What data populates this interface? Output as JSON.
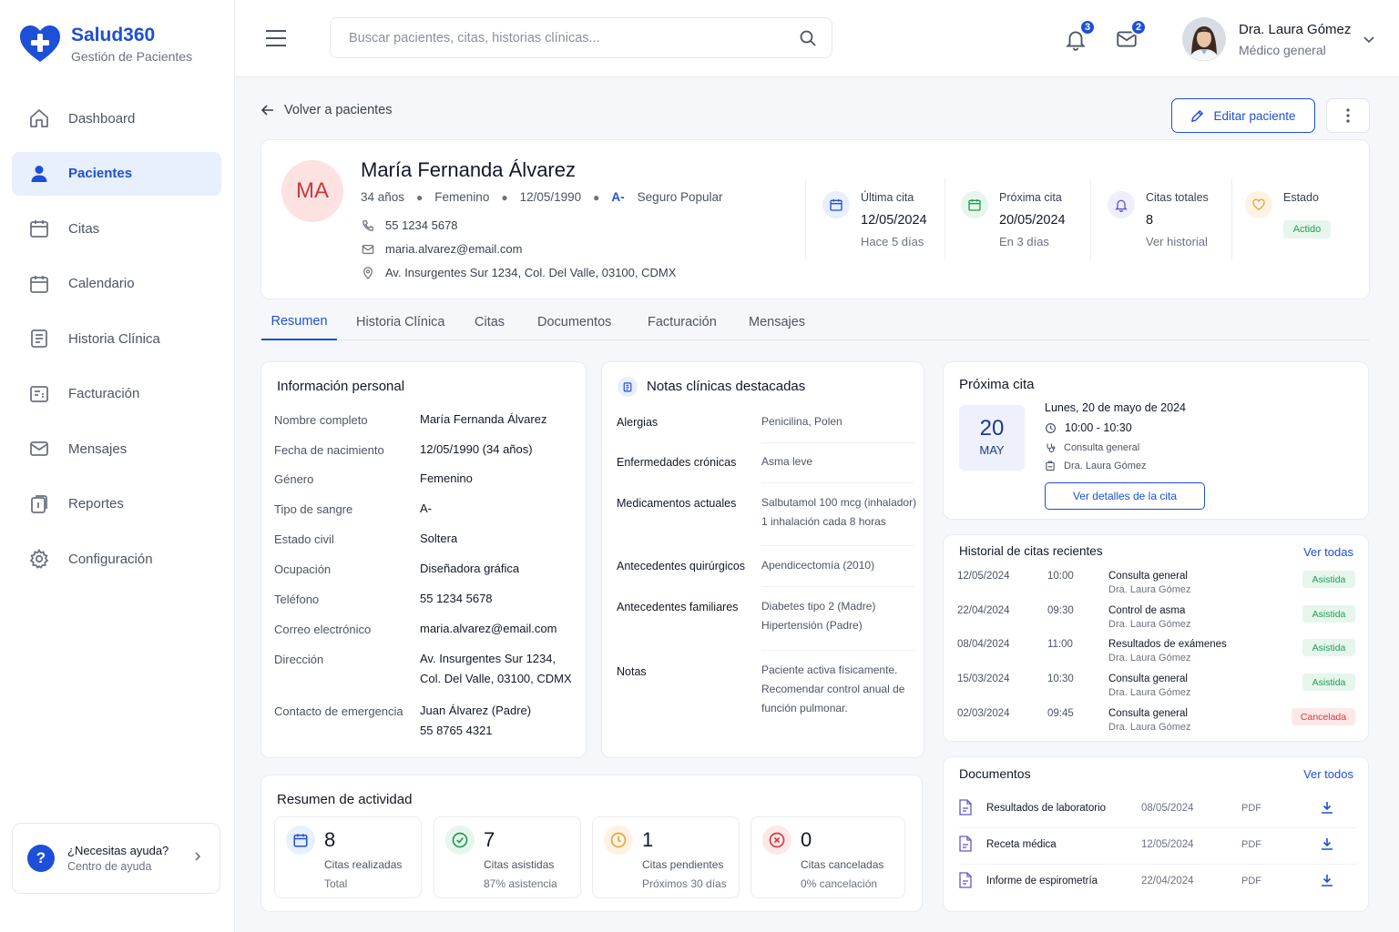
{
  "brand": {
    "name": "Salud360",
    "subtitle": "Gestión de Pacientes",
    "logo_icon": "heart-plus-icon",
    "color": "#1e4fd8"
  },
  "sidebar": {
    "items": [
      {
        "label": "Dashboard",
        "icon": "home-icon",
        "active": false
      },
      {
        "label": "Pacientes",
        "icon": "user-icon",
        "active": true
      },
      {
        "label": "Citas",
        "icon": "calendar-icon",
        "active": false
      },
      {
        "label": "Calendario",
        "icon": "calendar-icon",
        "active": false
      },
      {
        "label": "Historia Clínica",
        "icon": "document-icon",
        "active": false
      },
      {
        "label": "Facturación",
        "icon": "invoice-icon",
        "active": false
      },
      {
        "label": "Mensajes",
        "icon": "mail-icon",
        "active": false
      },
      {
        "label": "Reportes",
        "icon": "report-icon",
        "active": false
      },
      {
        "label": "Configuración",
        "icon": "gear-icon",
        "active": false
      }
    ],
    "help": {
      "title": "¿Necesitas ayuda?",
      "subtitle": "Centro de ayuda",
      "icon_text": "?"
    }
  },
  "header": {
    "search_placeholder": "Buscar pacientes, citas, historias clínicas...",
    "notifications_count": "3",
    "messages_count": "2",
    "user": {
      "name": "Dra. Laura Gómez",
      "role": "Médico general"
    }
  },
  "actions": {
    "back_label": "Volver a pacientes",
    "edit_label": "Editar paciente"
  },
  "patient": {
    "initials": "MA",
    "name": "María Fernanda Álvarez",
    "age": "34 años",
    "gender": "Femenino",
    "dob": "12/05/1990",
    "blood": "A-",
    "insurance": "Seguro Popular",
    "phone": "55 1234 5678",
    "email": "maria.alvarez@email.com",
    "address": "Av. Insurgentes Sur 1234, Col. Del Valle, 03100, CDMX",
    "stats": [
      {
        "label": "Última cita",
        "value": "12/05/2024",
        "sub": "Hace 5 días",
        "icon": "calendar-icon",
        "color": "#1e4fd8",
        "bg": "#e8effd"
      },
      {
        "label": "Próxima cita",
        "value": "20/05/2024",
        "sub": "En 3 días",
        "icon": "calendar-icon",
        "color": "#1f9d55",
        "bg": "#e7f6ec"
      },
      {
        "label": "Citas totales",
        "value": "8",
        "sub": "Ver historial",
        "icon": "bell-icon",
        "color": "#5d59c7",
        "bg": "#efeefd"
      },
      {
        "label": "Estado",
        "value": "Actido",
        "icon": "heart-icon",
        "color": "#e9a23b",
        "bg": "#fdf3e4"
      }
    ]
  },
  "tabs": [
    {
      "label": "Resumen",
      "active": true
    },
    {
      "label": "Historia Clínica",
      "active": false
    },
    {
      "label": "Citas",
      "active": false
    },
    {
      "label": "Documentos",
      "active": false
    },
    {
      "label": "Facturación",
      "active": false
    },
    {
      "label": "Mensajes",
      "active": false
    }
  ],
  "personal": {
    "title": "Información personal",
    "rows": [
      {
        "label": "Nombre completo",
        "value": "María Fernanda Álvarez"
      },
      {
        "label": "Fecha de nacimiento",
        "value": "12/05/1990 (34 años)"
      },
      {
        "label": "Género",
        "value": "Femenino"
      },
      {
        "label": "Tipo de sangre",
        "value": "A-"
      },
      {
        "label": "Estado civil",
        "value": "Soltera"
      },
      {
        "label": "Ocupación",
        "value": "Diseñadora gráfica"
      },
      {
        "label": "Teléfono",
        "value": "55 1234 5678"
      },
      {
        "label": "Correo electrónico",
        "value": "maria.alvarez@email.com"
      },
      {
        "label": "Dirección",
        "value": "Av. Insurgentes Sur 1234,",
        "value2": "Col. Del Valle, 03100, CDMX"
      },
      {
        "label": "Contacto de emergencia",
        "value": "Juan Álvarez (Padre)",
        "value2": "55 8765 4321"
      }
    ]
  },
  "notes": {
    "title": "Notas clínicas destacadas",
    "rows": [
      {
        "label": "Alergias",
        "lines": [
          "Penicilina, Polen"
        ]
      },
      {
        "label": "Enfermedades crónicas",
        "lines": [
          "Asma leve"
        ]
      },
      {
        "label": "Medicamentos actuales",
        "lines": [
          "Salbutamol 100 mcg (inhalador)",
          "1 inhalación cada 8 horas"
        ]
      },
      {
        "label": "Antecedentes quirúrgicos",
        "lines": [
          "Apendicectomía (2010)"
        ]
      },
      {
        "label": "Antecedentes familiares",
        "lines": [
          "Diabetes tipo 2 (Madre)",
          "Hipertensión (Padre)"
        ]
      },
      {
        "label": "Notas",
        "lines": [
          "Paciente activa físicamente.",
          "Recomendar control anual de",
          "función pulmonar."
        ]
      }
    ]
  },
  "activity": {
    "title": "Resumen de actividad",
    "items": [
      {
        "num": "8",
        "l1": "Citas realizadas",
        "l2": "Total",
        "icon": "calendar-icon",
        "color": "#1e4fd8",
        "bg": "#e8effd"
      },
      {
        "num": "7",
        "l1": "Citas asistidas",
        "l2": "87% asistencia",
        "icon": "check-circle-icon",
        "color": "#1f9d55",
        "bg": "#e7f6ec"
      },
      {
        "num": "1",
        "l1": "Citas pendientes",
        "l2": "Próximos 30 días",
        "icon": "clock-icon",
        "color": "#e9a23b",
        "bg": "#fdf3e4"
      },
      {
        "num": "0",
        "l1": "Citas canceladas",
        "l2": "0% cancelación",
        "icon": "x-circle-icon",
        "color": "#d33b3b",
        "bg": "#fde8e8"
      }
    ]
  },
  "next_appt": {
    "title": "Próxima cita",
    "day": "20",
    "month": "MAY",
    "weekday": "Lunes,",
    "date": "20 de mayo de 2024",
    "time": "10:00 - 10:30",
    "type": "Consulta general",
    "doctor": "Dra. Laura Gómez",
    "button": "Ver detalles de la cita"
  },
  "history": {
    "title": "Historial de citas recientes",
    "link": "Ver todas",
    "rows": [
      {
        "date": "12/05/2024",
        "time": "10:00",
        "type": "Consulta general",
        "doctor": "Dra. Laura Gómez",
        "status": "Asistida",
        "ok": true
      },
      {
        "date": "22/04/2024",
        "time": "09:30",
        "type": "Control de asma",
        "doctor": "Dra. Laura Gómez",
        "status": "Asistida",
        "ok": true
      },
      {
        "date": "08/04/2024",
        "time": "11:00",
        "type": "Resultados de exámenes",
        "doctor": "Dra. Laura Gómez",
        "status": "Asistida",
        "ok": true
      },
      {
        "date": "15/03/2024",
        "time": "10:30",
        "type": "Consulta general",
        "doctor": "Dra. Laura Gómez",
        "status": "Asistida",
        "ok": true
      },
      {
        "date": "02/03/2024",
        "time": "09:45",
        "type": "Consulta general",
        "doctor": "Dra. Laura Gómez",
        "status": "Cancelada",
        "ok": false
      }
    ]
  },
  "documents": {
    "title": "Documentos",
    "link": "Ver todos",
    "rows": [
      {
        "name": "Resultados de laboratorio",
        "date": "08/05/2024",
        "type": "PDF"
      },
      {
        "name": "Receta médica",
        "date": "12/05/2024",
        "type": "PDF"
      },
      {
        "name": "Informe de espirometría",
        "date": "22/04/2024",
        "type": "PDF"
      }
    ]
  }
}
